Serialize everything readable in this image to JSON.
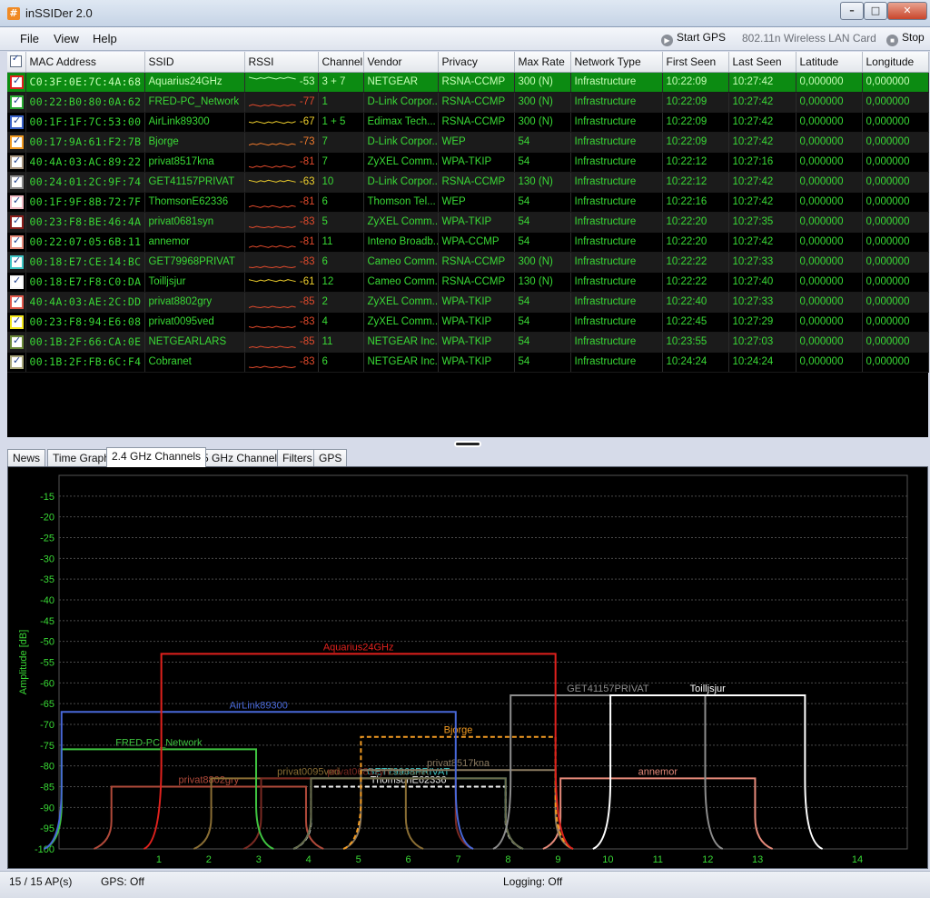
{
  "window": {
    "title": "inSSIDer 2.0",
    "app_icon": "#"
  },
  "menu": {
    "items": [
      "File",
      "View",
      "Help"
    ],
    "start_gps": "Start GPS",
    "adapter": "802.11n Wireless LAN Card",
    "stop": "Stop"
  },
  "table": {
    "columns": [
      "MAC Address",
      "SSID",
      "RSSI",
      "Channel",
      "Vendor",
      "Privacy",
      "Max Rate",
      "Network Type",
      "First Seen",
      "Last Seen",
      "Latitude",
      "Longitude"
    ],
    "rows": [
      {
        "color": "#e0211d",
        "mac": "C0:3F:0E:7C:4A:68",
        "ssid": "Aquarius24GHz",
        "rssi": "-53",
        "channel": "3 + 7",
        "vendor": "NETGEAR",
        "privacy": "RSNA-CCMP",
        "max_rate": "300 (N)",
        "network_type": "Infrastructure",
        "first_seen": "10:22:09",
        "last_seen": "10:27:42",
        "latitude": "0,000000",
        "longitude": "0,000000",
        "rssi_color": "#b8ffb0"
      },
      {
        "color": "#2aa834",
        "mac": "00:22:B0:80:0A:62",
        "ssid": "FRED-PC_Network",
        "rssi": "-77",
        "channel": "1",
        "vendor": "D-Link Corpor...",
        "privacy": "RSNA-CCMP",
        "max_rate": "300 (N)",
        "network_type": "Infrastructure",
        "first_seen": "10:22:09",
        "last_seen": "10:27:42",
        "latitude": "0,000000",
        "longitude": "0,000000",
        "rssi_color": "#e24a2c"
      },
      {
        "color": "#3a63c9",
        "mac": "00:1F:1F:7C:53:00",
        "ssid": "AirLink89300",
        "rssi": "-67",
        "channel": "1 + 5",
        "vendor": "Edimax Tech...",
        "privacy": "RSNA-CCMP",
        "max_rate": "300 (N)",
        "network_type": "Infrastructure",
        "first_seen": "10:22:09",
        "last_seen": "10:27:42",
        "latitude": "0,000000",
        "longitude": "0,000000",
        "rssi_color": "#f0d02c"
      },
      {
        "color": "#f19a22",
        "mac": "00:17:9A:61:F2:7B",
        "ssid": "Bjorge",
        "rssi": "-73",
        "channel": "7",
        "vendor": "D-Link Corpor...",
        "privacy": "WEP",
        "max_rate": "54",
        "network_type": "Infrastructure",
        "first_seen": "10:22:09",
        "last_seen": "10:27:42",
        "latitude": "0,000000",
        "longitude": "0,000000",
        "rssi_color": "#f07a2c"
      },
      {
        "color": "#a89680",
        "mac": "40:4A:03:AC:89:22",
        "ssid": "privat8517kna",
        "rssi": "-81",
        "channel": "7",
        "vendor": "ZyXEL Comm...",
        "privacy": "WPA-TKIP",
        "max_rate": "54",
        "network_type": "Infrastructure",
        "first_seen": "10:22:12",
        "last_seen": "10:27:16",
        "latitude": "0,000000",
        "longitude": "0,000000",
        "rssi_color": "#e24a2c"
      },
      {
        "color": "#8d8d8d",
        "mac": "00:24:01:2C:9F:74",
        "ssid": "GET41157PRIVAT",
        "rssi": "-63",
        "channel": "10",
        "vendor": "D-Link Corpor...",
        "privacy": "RSNA-CCMP",
        "max_rate": "130 (N)",
        "network_type": "Infrastructure",
        "first_seen": "10:22:12",
        "last_seen": "10:27:42",
        "latitude": "0,000000",
        "longitude": "0,000000",
        "rssi_color": "#f0d02c"
      },
      {
        "color": "#f0b9c2",
        "mac": "00:1F:9F:8B:72:7F",
        "ssid": "ThomsonE62336",
        "rssi": "-81",
        "channel": "6",
        "vendor": "Thomson Tel...",
        "privacy": "WEP",
        "max_rate": "54",
        "network_type": "Infrastructure",
        "first_seen": "10:22:16",
        "last_seen": "10:27:42",
        "latitude": "0,000000",
        "longitude": "0,000000",
        "rssi_color": "#e24a2c"
      },
      {
        "color": "#8b1f1c",
        "mac": "00:23:F8:BE:46:4A",
        "ssid": "privat0681syn",
        "rssi": "-83",
        "channel": "5",
        "vendor": "ZyXEL Comm...",
        "privacy": "WPA-TKIP",
        "max_rate": "54",
        "network_type": "Infrastructure",
        "first_seen": "10:22:20",
        "last_seen": "10:27:35",
        "latitude": "0,000000",
        "longitude": "0,000000",
        "rssi_color": "#e24a2c"
      },
      {
        "color": "#e58a7a",
        "mac": "00:22:07:05:6B:11",
        "ssid": "annemor",
        "rssi": "-81",
        "channel": "11",
        "vendor": "Inteno Broadb...",
        "privacy": "WPA-CCMP",
        "max_rate": "54",
        "network_type": "Infrastructure",
        "first_seen": "10:22:20",
        "last_seen": "10:27:42",
        "latitude": "0,000000",
        "longitude": "0,000000",
        "rssi_color": "#e24a2c"
      },
      {
        "color": "#3fc6c6",
        "mac": "00:18:E7:CE:14:BC",
        "ssid": "GET79968PRIVAT",
        "rssi": "-83",
        "channel": "6",
        "vendor": "Cameo Comm...",
        "privacy": "RSNA-CCMP",
        "max_rate": "300 (N)",
        "network_type": "Infrastructure",
        "first_seen": "10:22:22",
        "last_seen": "10:27:33",
        "latitude": "0,000000",
        "longitude": "0,000000",
        "rssi_color": "#e24a2c"
      },
      {
        "color": "#f4f4f4",
        "mac": "00:18:E7:F8:C0:DA",
        "ssid": "Toilljsjur",
        "rssi": "-61",
        "channel": "12",
        "vendor": "Cameo Comm...",
        "privacy": "RSNA-CCMP",
        "max_rate": "130 (N)",
        "network_type": "Infrastructure",
        "first_seen": "10:22:22",
        "last_seen": "10:27:40",
        "latitude": "0,000000",
        "longitude": "0,000000",
        "rssi_color": "#f0d02c"
      },
      {
        "color": "#e25a4c",
        "mac": "40:4A:03:AE:2C:DD",
        "ssid": "privat8802gry",
        "rssi": "-85",
        "channel": "2",
        "vendor": "ZyXEL Comm...",
        "privacy": "WPA-TKIP",
        "max_rate": "54",
        "network_type": "Infrastructure",
        "first_seen": "10:22:40",
        "last_seen": "10:27:33",
        "latitude": "0,000000",
        "longitude": "0,000000",
        "rssi_color": "#e24a2c"
      },
      {
        "color": "#f2e61c",
        "mac": "00:23:F8:94:E6:08",
        "ssid": "privat0095ved",
        "rssi": "-83",
        "channel": "4",
        "vendor": "ZyXEL Comm...",
        "privacy": "WPA-TKIP",
        "max_rate": "54",
        "network_type": "Infrastructure",
        "first_seen": "10:22:45",
        "last_seen": "10:27:29",
        "latitude": "0,000000",
        "longitude": "0,000000",
        "rssi_color": "#e24a2c"
      },
      {
        "color": "#6d8a3a",
        "mac": "00:1B:2F:66:CA:0E",
        "ssid": "NETGEARLARS",
        "rssi": "-85",
        "channel": "11",
        "vendor": "NETGEAR Inc.",
        "privacy": "WPA-TKIP",
        "max_rate": "54",
        "network_type": "Infrastructure",
        "first_seen": "10:23:55",
        "last_seen": "10:27:03",
        "latitude": "0,000000",
        "longitude": "0,000000",
        "rssi_color": "#e24a2c"
      },
      {
        "color": "#a8a67a",
        "mac": "00:1B:2F:FB:6C:F4",
        "ssid": "Cobranet",
        "rssi": "-83",
        "channel": "6",
        "vendor": "NETGEAR Inc.",
        "privacy": "WPA-TKIP",
        "max_rate": "54",
        "network_type": "Infrastructure",
        "first_seen": "10:24:24",
        "last_seen": "10:24:24",
        "latitude": "0,000000",
        "longitude": "0,000000",
        "rssi_color": "#e24a2c"
      }
    ]
  },
  "tabs": [
    "News",
    "Time Graph",
    "2.4 GHz Channels",
    "5 GHz Channels",
    "Filters",
    "GPS"
  ],
  "active_tab": "2.4 GHz Channels",
  "chart_data": {
    "type": "area",
    "ylabel": "Amplitude [dB]",
    "ylim": [
      -100,
      -10
    ],
    "yticks": [
      -15,
      -20,
      -25,
      -30,
      -35,
      -40,
      -45,
      -50,
      -55,
      -60,
      -65,
      -70,
      -75,
      -80,
      -85,
      -90,
      -95,
      -100
    ],
    "xticks": [
      "1",
      "2",
      "3",
      "4",
      "5",
      "6",
      "7",
      "8",
      "9",
      "10",
      "11",
      "12",
      "13",
      "14"
    ],
    "xlim": [
      -1,
      16
    ],
    "grid": true,
    "series": [
      {
        "name": "Aquarius24GHz",
        "color": "#e0211d",
        "center": 5,
        "width": 8,
        "rssi": -53,
        "dashed": false
      },
      {
        "name": "AirLink89300",
        "color": "#4868d8",
        "center": 3,
        "width": 8,
        "rssi": -67,
        "dashed": false
      },
      {
        "name": "FRED-PC_Network",
        "color": "#3fc340",
        "center": 1,
        "width": 4,
        "rssi": -76,
        "dashed": false
      },
      {
        "name": "Bjorge",
        "color": "#f19a22",
        "center": 7,
        "width": 4,
        "rssi": -73,
        "dashed": true
      },
      {
        "name": "GET41157PRIVAT",
        "color": "#8d8d8d",
        "center": 10,
        "width": 4,
        "rssi": -63,
        "dashed": false
      },
      {
        "name": "Toilljsjur",
        "color": "#ffffff",
        "center": 12,
        "width": 4,
        "rssi": -63,
        "dashed": false
      },
      {
        "name": "annemor",
        "color": "#e58a7a",
        "center": 11,
        "width": 4,
        "rssi": -83,
        "dashed": false
      },
      {
        "name": "privat8802gry",
        "color": "#b14a3a",
        "center": 2,
        "width": 4,
        "rssi": -85,
        "dashed": false
      },
      {
        "name": "privat0095ved",
        "color": "#8a6e34",
        "center": 4,
        "width": 4,
        "rssi": -83,
        "dashed": false
      },
      {
        "name": "GET79968PRIVAT",
        "color": "#3fc6c6",
        "center": 6,
        "width": 4,
        "rssi": -83,
        "dashed": false
      },
      {
        "name": "ThomsonE62336",
        "color": "#f2f2f2",
        "center": 6,
        "width": 4,
        "rssi": -85,
        "dashed": true
      },
      {
        "name": "privat0681syn",
        "color": "#7a2a22",
        "center": 5,
        "width": 4,
        "rssi": -83,
        "dashed": false
      },
      {
        "name": "privat8517kna",
        "color": "#8a7a60",
        "center": 7,
        "width": 4,
        "rssi": -81,
        "dashed": false
      },
      {
        "name": "Cobranet",
        "color": "#6b6a4a",
        "center": 6,
        "width": 4,
        "rssi": -83,
        "dashed": false
      }
    ]
  },
  "status": {
    "ap_count": "15 / 15 AP(s)",
    "gps": "GPS: Off",
    "logging": "Logging: Off"
  }
}
